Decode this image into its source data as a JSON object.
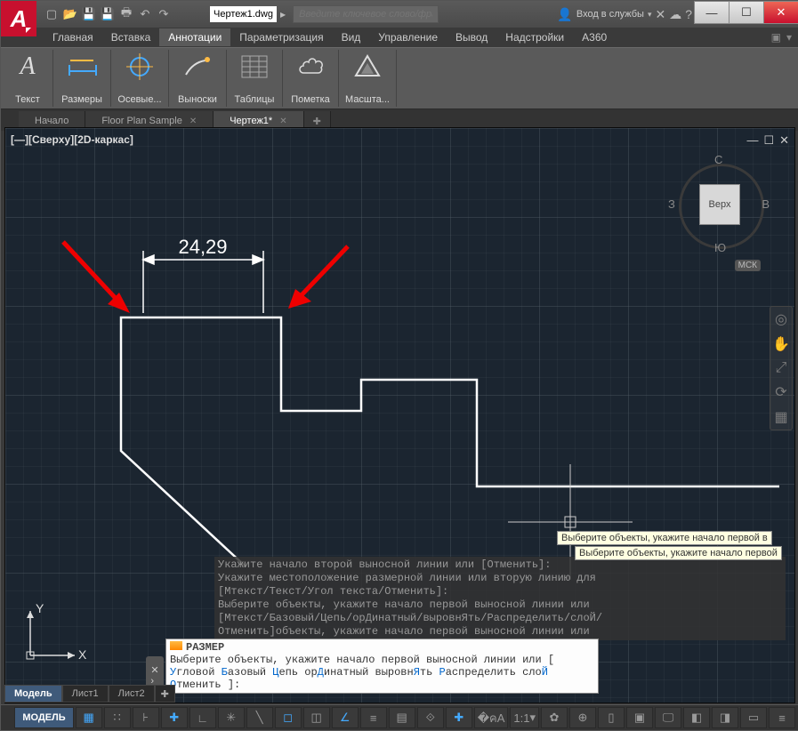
{
  "title": {
    "filename": "Чертеж1.dwg",
    "search_placeholder": "Введите ключевое слово/фразу",
    "signin": "Вход в службы"
  },
  "menu": {
    "items": [
      "Главная",
      "Вставка",
      "Аннотации",
      "Параметризация",
      "Вид",
      "Управление",
      "Вывод",
      "Надстройки",
      "A360"
    ],
    "active_index": 2
  },
  "ribbon": {
    "panels": [
      {
        "label": "Текст",
        "icon": "A"
      },
      {
        "label": "Размеры",
        "icon": "dim"
      },
      {
        "label": "Осевые...",
        "icon": "center"
      },
      {
        "label": "Выноски",
        "icon": "leader"
      },
      {
        "label": "Таблицы",
        "icon": "table"
      },
      {
        "label": "Пометка",
        "icon": "cloud"
      },
      {
        "label": "Масшта...",
        "icon": "scale"
      }
    ]
  },
  "filetabs": {
    "items": [
      "Начало",
      "Floor Plan Sample",
      "Чертеж1*"
    ],
    "active_index": 2
  },
  "viewport": {
    "label": "[—][Сверху][2D-каркас]",
    "cube": {
      "face": "Верх",
      "n": "С",
      "s": "Ю",
      "e": "В",
      "w": "З"
    },
    "wcs": "МСК"
  },
  "drawing": {
    "dimension_value": "24,29"
  },
  "ucs": {
    "x": "X",
    "y": "Y"
  },
  "command": {
    "history": [
      "Укажите начало второй выносной линии или [Отменить]:",
      "Укажите местоположение размерной линии или вторую линию для",
      "[Мтекст/Текст/Угол текста/Отменить]:",
      "Выберите объекты, укажите начало первой выносной линии или",
      "[Мтекст/Базовый/Цепь/орДинатный/выровнЯть/Распределить/слоЙ/",
      "Отменить]объекты, укажите начало первой выносной линии или"
    ],
    "name": "РАЗМЕР",
    "prompt_pre": "Выберите объекты, укажите начало первой выносной линии или [",
    "opts": [
      "Угловой",
      "Базовый",
      "Цепь",
      "орДинатный",
      "выровнЯть",
      "Распределить",
      "слоЙ",
      "Отменить"
    ],
    "prompt_post": "]:"
  },
  "tooltips": {
    "t1": "Выберите объекты, укажите начало первой в",
    "t2": "Выберите объекты, укажите начало первой"
  },
  "bottomtabs": {
    "items": [
      "Модель",
      "Лист1",
      "Лист2"
    ],
    "active_index": 0
  },
  "status": {
    "model": "МОДЕЛЬ",
    "scale": "1:1"
  }
}
